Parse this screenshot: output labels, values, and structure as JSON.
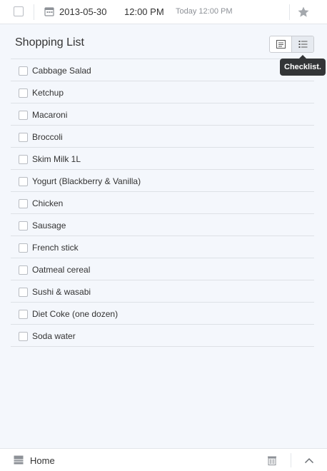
{
  "header": {
    "date": "2013-05-30",
    "time": "12:00 PM",
    "reminder": "Today 12:00 PM"
  },
  "note": {
    "title": "Shopping List",
    "tooltip": "Checklist.",
    "items": [
      "Cabbage Salad",
      "Ketchup",
      "Macaroni",
      "Broccoli",
      "Skim Milk 1L",
      "Yogurt (Blackberry & Vanilla)",
      "Chicken",
      "Sausage",
      "French stick",
      "Oatmeal cereal",
      "Sushi & wasabi",
      "Diet Coke (one dozen)",
      "Soda water"
    ]
  },
  "footer": {
    "notebook": "Home"
  },
  "icons": [
    "checkbox",
    "calendar-icon",
    "star-icon",
    "note-view-icon",
    "checklist-view-icon",
    "notebook-icon",
    "trash-icon",
    "chevron-up-icon"
  ]
}
